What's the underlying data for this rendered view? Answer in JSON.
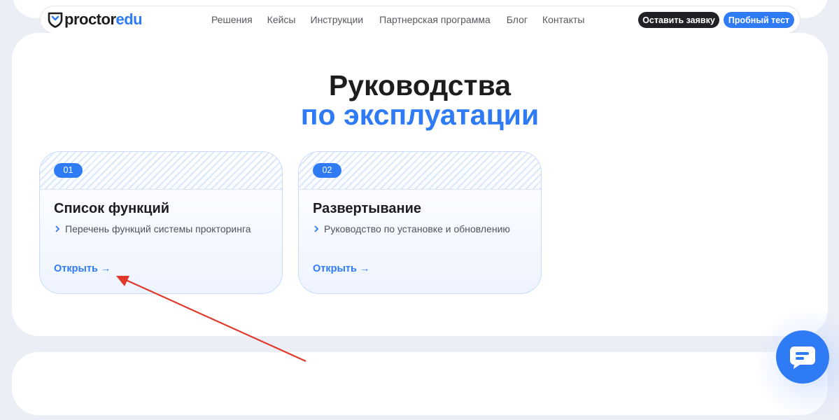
{
  "header": {
    "logo": {
      "part1": "proctor",
      "part2": "edu"
    },
    "nav": [
      {
        "label": "Решения"
      },
      {
        "label": "Кейсы"
      },
      {
        "label": "Инструкции"
      },
      {
        "label": "Партнерская программа"
      },
      {
        "label": "Блог"
      },
      {
        "label": "Контакты"
      }
    ],
    "request_button": "Оставить заявку",
    "trial_button": "Пробный тест"
  },
  "main": {
    "title_line1": "Руководства",
    "title_line2": "по эксплуатации",
    "guides": [
      {
        "number": "01",
        "title": "Список функций",
        "description": "Перечень функций системы прокторинга",
        "link": "Открыть",
        "arrow": "→"
      },
      {
        "number": "02",
        "title": "Развертывание",
        "description": "Руководство по установке и обновлению",
        "link": "Открыть",
        "arrow": "→"
      }
    ]
  },
  "icons": {
    "logo": "shield-icon",
    "bullet": "chevron-right-icon",
    "chat": "chat-bubble-icon",
    "annotation": "red-arrow-annotation"
  },
  "colors": {
    "accent": "#2f7bf5",
    "dark_button": "#202124",
    "page_background": "#eceef6",
    "annotation_arrow": "#e0392b"
  }
}
